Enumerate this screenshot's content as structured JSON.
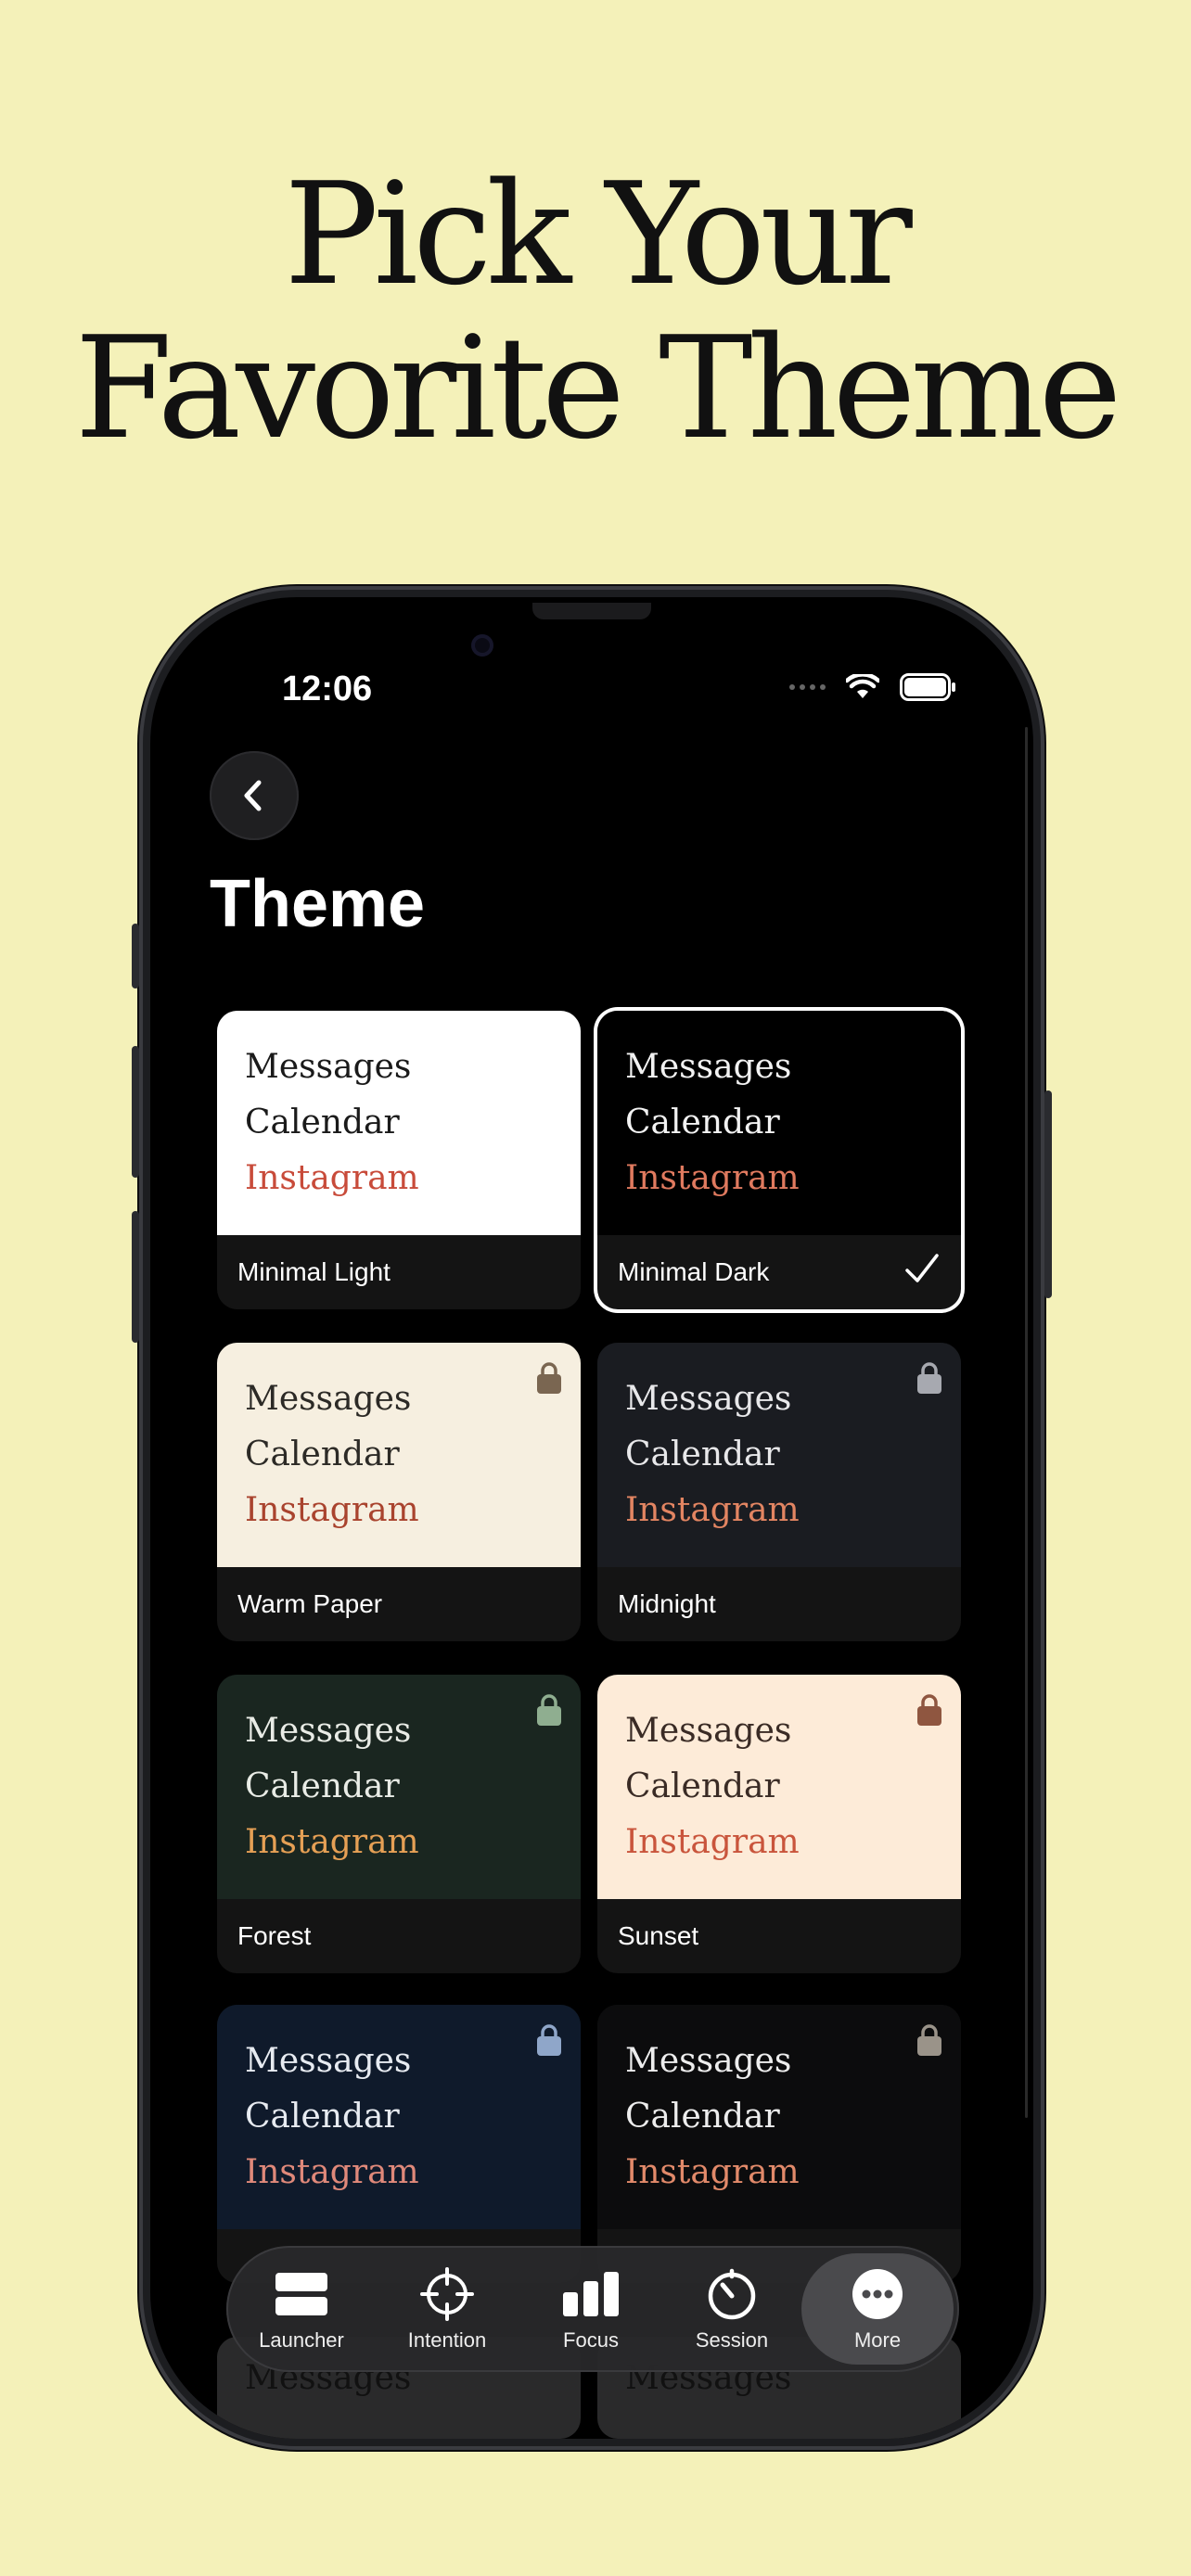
{
  "headline": {
    "line1": "Pick Your",
    "line2": "Favorite Theme"
  },
  "status": {
    "time": "12:06"
  },
  "page": {
    "title": "Theme"
  },
  "themes": [
    {
      "name": "Minimal Light",
      "bg": "#ffffff",
      "text": "#1a1a1a",
      "accent": "#c84b3a",
      "lock": null,
      "selected": false,
      "lines": [
        "Messages",
        "Calendar",
        "Instagram"
      ]
    },
    {
      "name": "Minimal Dark",
      "bg": "#000000",
      "text": "#f2f2f2",
      "accent": "#e07a5f",
      "lock": null,
      "selected": true,
      "lines": [
        "Messages",
        "Calendar",
        "Instagram"
      ]
    },
    {
      "name": "Warm Paper",
      "bg": "#f6efe0",
      "text": "#2c2a26",
      "accent": "#a9432e",
      "lock": "#7a6651",
      "selected": false,
      "lines": [
        "Messages",
        "Calendar",
        "Instagram"
      ]
    },
    {
      "name": "Midnight",
      "bg": "#1a1c21",
      "text": "#e8e8ea",
      "accent": "#e38562",
      "lock": "#a7a9b0",
      "selected": false,
      "lines": [
        "Messages",
        "Calendar",
        "Instagram"
      ]
    },
    {
      "name": "Forest",
      "bg": "#1a2620",
      "text": "#e9ece6",
      "accent": "#e6a055",
      "lock": "#8fae90",
      "selected": false,
      "lines": [
        "Messages",
        "Calendar",
        "Instagram"
      ]
    },
    {
      "name": "Sunset",
      "bg": "#fdebd8",
      "text": "#3a2b25",
      "accent": "#c9553c",
      "lock": "#8f5640",
      "selected": false,
      "lines": [
        "Messages",
        "Calendar",
        "Instagram"
      ]
    },
    {
      "name": "",
      "bg": "#0f1a2b",
      "text": "#e7ebf1",
      "accent": "#e0897a",
      "lock": "#8fa6c9",
      "selected": false,
      "lines": [
        "Messages",
        "Calendar",
        "Instagram"
      ]
    },
    {
      "name": "",
      "bg": "#0c0c0d",
      "text": "#ededed",
      "accent": "#e28a6a",
      "lock": "#9a9389",
      "selected": false,
      "lines": [
        "Messages",
        "Calendar",
        "Instagram"
      ]
    }
  ],
  "partial_row": {
    "left": "Messages",
    "right": "Messages"
  },
  "tabbar": [
    {
      "label": "Launcher",
      "icon": "launcher-icon"
    },
    {
      "label": "Intention",
      "icon": "crosshair-icon"
    },
    {
      "label": "Focus",
      "icon": "bar-chart-icon"
    },
    {
      "label": "Session",
      "icon": "timer-icon"
    },
    {
      "label": "More",
      "icon": "more-icon",
      "active": true
    }
  ]
}
